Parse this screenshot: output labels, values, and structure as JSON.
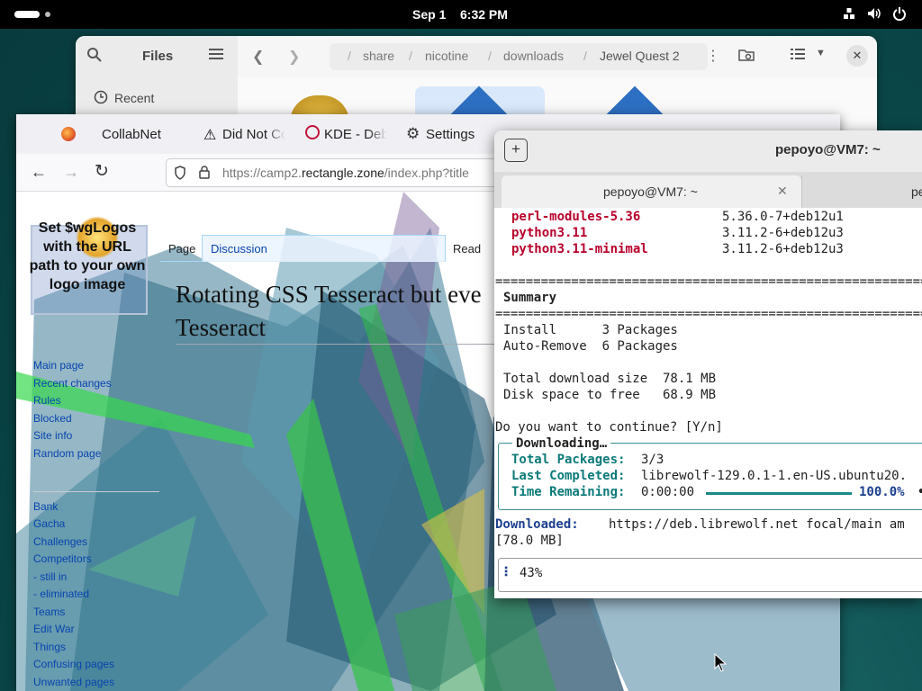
{
  "topbar": {
    "date": "Sep 1",
    "time": "6:32 PM",
    "tray": [
      "network-icon",
      "volume-icon",
      "power-icon"
    ]
  },
  "files": {
    "title": "Files",
    "sidebar_item": "Recent",
    "breadcrumbs": [
      "share",
      "nicotine",
      "downloads",
      "Jewel Quest 2"
    ],
    "crumb_sep": "/"
  },
  "browser": {
    "tabs": [
      "CollabNet",
      "Did Not Co",
      "KDE - Deb",
      "Settings"
    ],
    "url_prefix": "https://camp2.",
    "url_domain": "rectangle.zone",
    "url_suffix": "/index.php?title"
  },
  "wiki": {
    "logo_placeholder": "Set $wgLogos with the URL path to your own logo image",
    "tab_page": "Page",
    "tab_discussion": "Discussion",
    "tab_read": "Read",
    "title_line1": "Rotating CSS Tesseract but eve",
    "title_line2": "Tesseract",
    "nav_links": [
      "Main page",
      "Recent changes",
      "Rules",
      "Blocked",
      "Site info",
      "Random page"
    ],
    "portal_links": [
      "Bank",
      "Gacha",
      "Challenges",
      "Competitors",
      "- still in",
      "- eliminated",
      "Teams",
      "Edit War",
      "Things",
      "Confusing pages",
      "Unwanted pages"
    ]
  },
  "terminal": {
    "title": "pepoyo@VM7: ~",
    "tab_active": "pepoyo@VM7: ~",
    "tab_second": "pe",
    "packages": [
      {
        "name": "perl-modules-5.36",
        "version": "5.36.0-7+deb12u1"
      },
      {
        "name": "python3.11",
        "version": "3.11.2-6+deb12u3"
      },
      {
        "name": "python3.11-minimal",
        "version": "3.11.2-6+deb12u3"
      }
    ],
    "rule": "==============================================================",
    "summary": "Summary",
    "install_line": "Install      3 Packages",
    "autoremove_line": "Auto-Remove  6 Packages",
    "dl_size_line": "Total download size  78.1 MB",
    "disk_line": "Disk space to free   68.9 MB",
    "prompt": "Do you want to continue? [Y/n]",
    "dl_title": "Downloading…",
    "dl_total_label": "Total Packages:",
    "dl_total_value": "3/3",
    "dl_last_label": "Last Completed:",
    "dl_last_value": "librewolf-129.0.1-1.en-US.ubuntu20.",
    "dl_time_label": "Time Remaining:",
    "dl_time_value": "0:00:00",
    "dl_pct": "100.0%",
    "dl_progress": 1.0,
    "downloaded_label": "Downloaded:",
    "downloaded_url": "https://deb.librewolf.net focal/main am",
    "downloaded_size": "[78.0 MB]",
    "pct_line": "43%"
  }
}
